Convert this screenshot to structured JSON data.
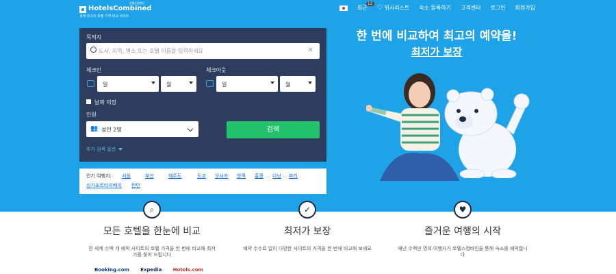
{
  "brand": {
    "name": "HotelsCombined",
    "tagline": "세계 최고의 호텔 가격 비교 사이트",
    "sub": "호텔스컴바인"
  },
  "nav": {
    "language": "한국어",
    "items": [
      "최근",
      "위시리스트",
      "숙소 등록하기",
      "고객센터",
      "로그인",
      "회원가입"
    ],
    "recent_badge": "12"
  },
  "search": {
    "destination_label": "목적지",
    "destination_placeholder": "도시, 지역, 명소 또는 호텔 이름을 입력하세요",
    "checkin_label": "체크인",
    "checkout_label": "체크아웃",
    "day_placeholder": "일",
    "month_placeholder": "월",
    "flexible_label": "날짜 미정",
    "guests_label": "인원",
    "guests_value": "성인 2명",
    "search_button": "검색",
    "more_options": "추가 검색 옵션"
  },
  "popular": {
    "title": "인기 여행지:",
    "cities": [
      "서울",
      "부산",
      "제주도",
      "도쿄",
      "오사카",
      "방콕",
      "홍콩",
      "다낭",
      "파리",
      "싱가포르",
      "타이베이",
      "런던"
    ]
  },
  "headline": {
    "line1": "한 번에 비교하여 최고의 예약을!",
    "line2": "최저가 보장"
  },
  "features": [
    {
      "icon": "search-icon",
      "title": "모든 호텔을 한눈에 비교",
      "desc": "전 세계 수백 개 예약 사이트의 호텔 가격을 한 번에 비교해 최저가를 찾아 드립니다"
    },
    {
      "icon": "check-icon",
      "title": "최저가 보장",
      "desc": "예약 수수료 없이 다양한 사이트의 가격을 한 번에 비교해 보세요"
    },
    {
      "icon": "heart-icon",
      "title": "즐거운 여행의 시작",
      "desc": "매년 수백만 명의 여행자가 호텔스컴바인을 통해 숙소를 예약합니다"
    }
  ],
  "partners": [
    "Booking.com",
    "Expedia",
    "Hotels.com"
  ],
  "colors": {
    "hero_bg": "#1fa3e8",
    "panel_bg": "#2e3d5e",
    "search_button": "#21c26b",
    "link": "#0770e3"
  }
}
